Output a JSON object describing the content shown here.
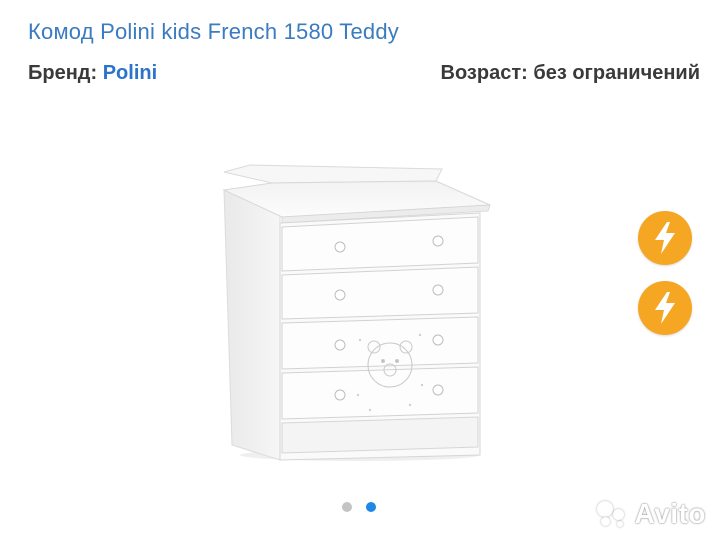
{
  "listing": {
    "title": "Комод Polini kids French 1580 Teddy",
    "brand_label": "Бренд:",
    "brand_value": "Polini",
    "age_label": "Возраст:",
    "age_value": "без ограничений"
  },
  "gallery": {
    "image_icon": "white-dresser-changing-table",
    "badges": [
      {
        "icon": "lightning-bolt-icon",
        "color": "#f5a623"
      },
      {
        "icon": "lightning-bolt-icon",
        "color": "#f5a623"
      }
    ],
    "pager": {
      "total": 2,
      "active_index": 1,
      "active_color": "#1e88e5",
      "inactive_color": "#c4c4c4"
    }
  },
  "watermark": {
    "text": "Avito"
  },
  "colors": {
    "title": "#3b7bbf",
    "brand_link": "#2c74c9",
    "text": "#3a3a3a"
  }
}
